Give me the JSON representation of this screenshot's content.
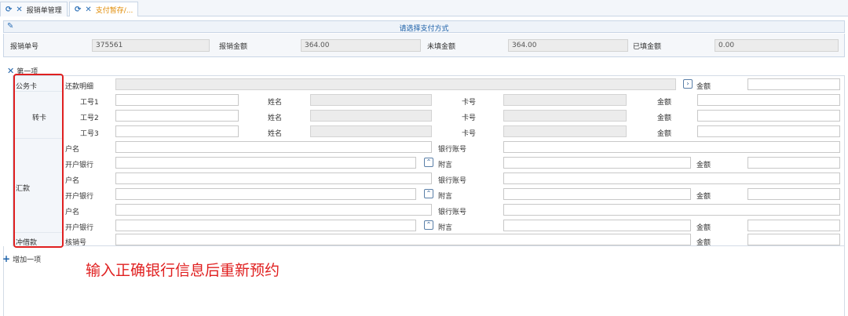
{
  "tabs": [
    {
      "label": "报销单管理"
    },
    {
      "label": "支付暂存/..."
    }
  ],
  "panel_title": "请选择支付方式",
  "summary": {
    "fields": [
      {
        "label": "报销单号",
        "value": "375561"
      },
      {
        "label": "报销金额",
        "value": "364.00"
      },
      {
        "label": "未填金额",
        "value": "364.00"
      },
      {
        "label": "已填金额",
        "value": "0.00"
      }
    ]
  },
  "section": {
    "title": "第一项",
    "add_label": "增加一项"
  },
  "form": {
    "gongwuka": {
      "category": "公务卡",
      "detail_label": "还款明细",
      "amount_label": "金额"
    },
    "zhuanka": {
      "category": "转卡",
      "rows": [
        {
          "label": "工号1",
          "name_label": "姓名",
          "card_label": "卡号",
          "amount_label": "金额"
        },
        {
          "label": "工号2",
          "name_label": "姓名",
          "card_label": "卡号",
          "amount_label": "金额"
        },
        {
          "label": "工号3",
          "name_label": "姓名",
          "card_label": "卡号",
          "amount_label": "金额"
        }
      ]
    },
    "huikuan": {
      "category": "汇款",
      "blocks": [
        {
          "account_name_label": "户名",
          "bank_account_label": "银行账号",
          "bank_label": "开户银行",
          "remark_label": "附言",
          "amount_label": "金额"
        },
        {
          "account_name_label": "户名",
          "bank_account_label": "银行账号",
          "bank_label": "开户银行",
          "remark_label": "附言",
          "amount_label": "金额"
        },
        {
          "account_name_label": "户名",
          "bank_account_label": "银行账号",
          "bank_label": "开户银行",
          "remark_label": "附言",
          "amount_label": "金额"
        }
      ]
    },
    "chongjie": {
      "category": "冲借款",
      "number_label": "核销号",
      "amount_label": "金额"
    }
  },
  "annotation": "输入正确银行信息后重新预约",
  "colors": {
    "accent": "#2b6fb6",
    "highlight": "#e02020",
    "active_tab": "#e08a00"
  }
}
